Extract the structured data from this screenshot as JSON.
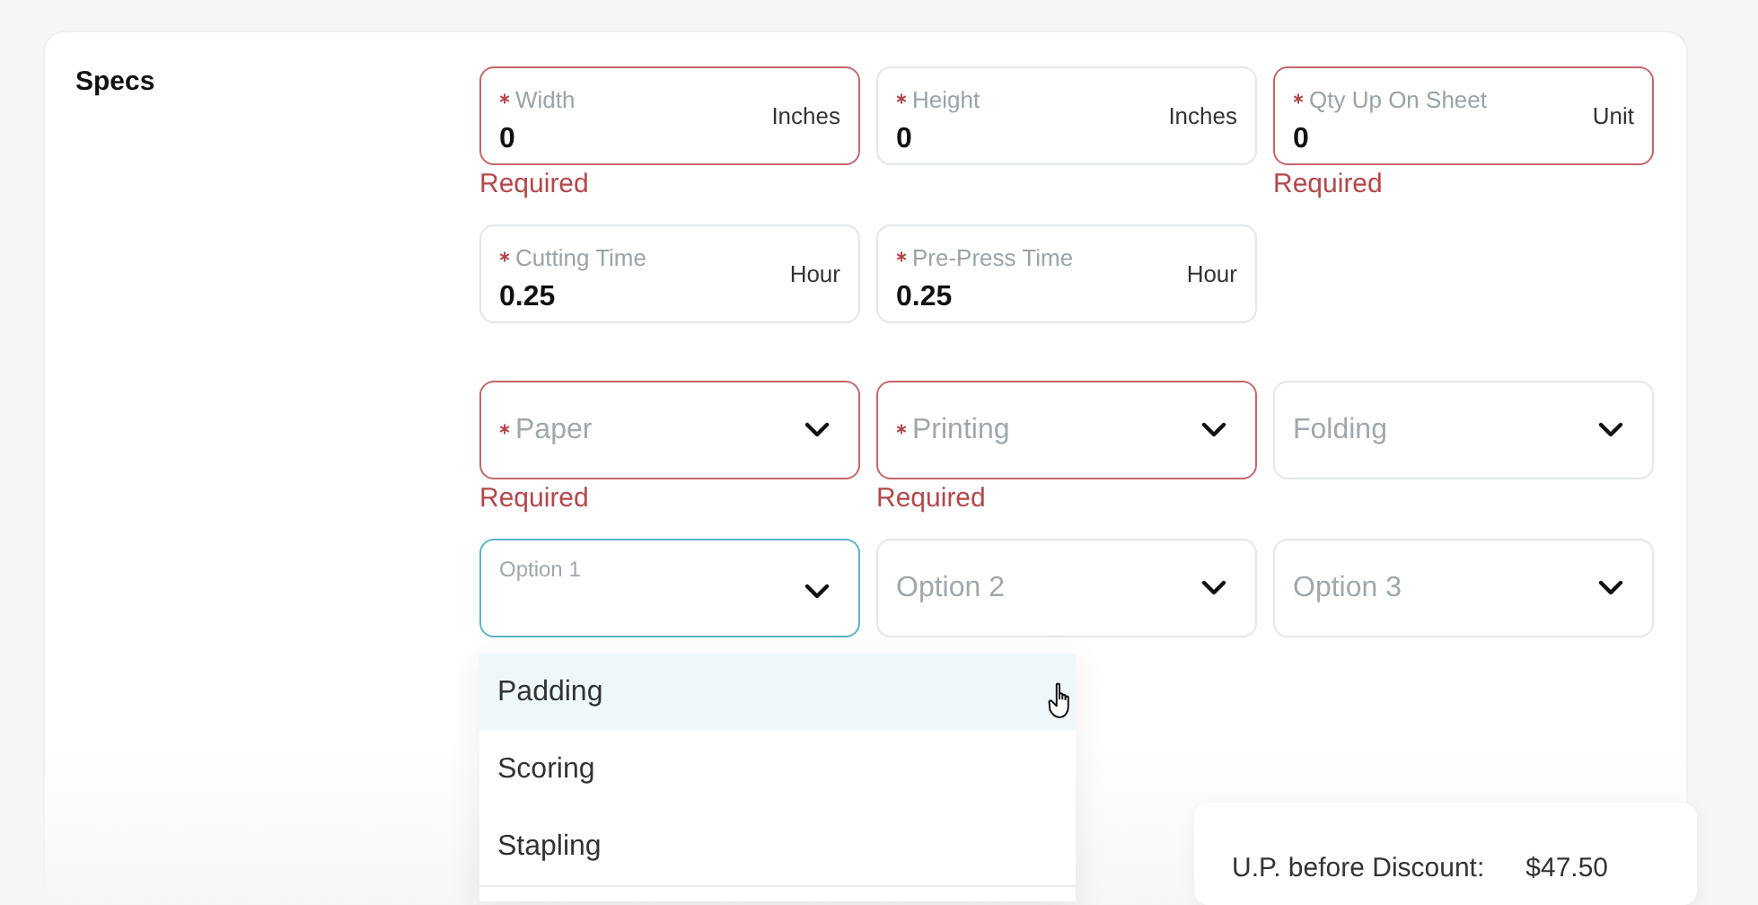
{
  "section": {
    "title": "Specs"
  },
  "input_rows": [
    [
      {
        "label": "Width",
        "required": true,
        "value": "0",
        "unit": "Inches",
        "error": "Required"
      },
      {
        "label": "Height",
        "required": true,
        "value": "0",
        "unit": "Inches"
      },
      {
        "label": "Qty Up On Sheet",
        "required": true,
        "value": "0",
        "unit": "Unit",
        "error": "Required"
      }
    ],
    [
      {
        "label": "Cutting Time",
        "required": true,
        "value": "0.25",
        "unit": "Hour"
      },
      {
        "label": "Pre-Press Time",
        "required": true,
        "value": "0.25",
        "unit": "Hour"
      }
    ]
  ],
  "select_rows": [
    [
      {
        "label": "Paper",
        "required": true,
        "focused": false,
        "error": "Required"
      },
      {
        "label": "Printing",
        "required": true,
        "focused": false,
        "error": "Required"
      },
      {
        "label": "Folding",
        "required": false,
        "focused": false
      }
    ],
    [
      {
        "label": "Option 1",
        "required": false,
        "focused": true
      },
      {
        "label": "Option 2",
        "required": false,
        "focused": false
      },
      {
        "label": "Option 3",
        "required": false,
        "focused": false
      }
    ]
  ],
  "dropdown": {
    "options": [
      {
        "label": "Padding",
        "selected": true
      },
      {
        "label": "Scoring",
        "selected": false
      },
      {
        "label": "Stapling",
        "selected": false
      }
    ]
  },
  "summary": {
    "label": "U.P. before Discount:",
    "value": "$47.50"
  }
}
